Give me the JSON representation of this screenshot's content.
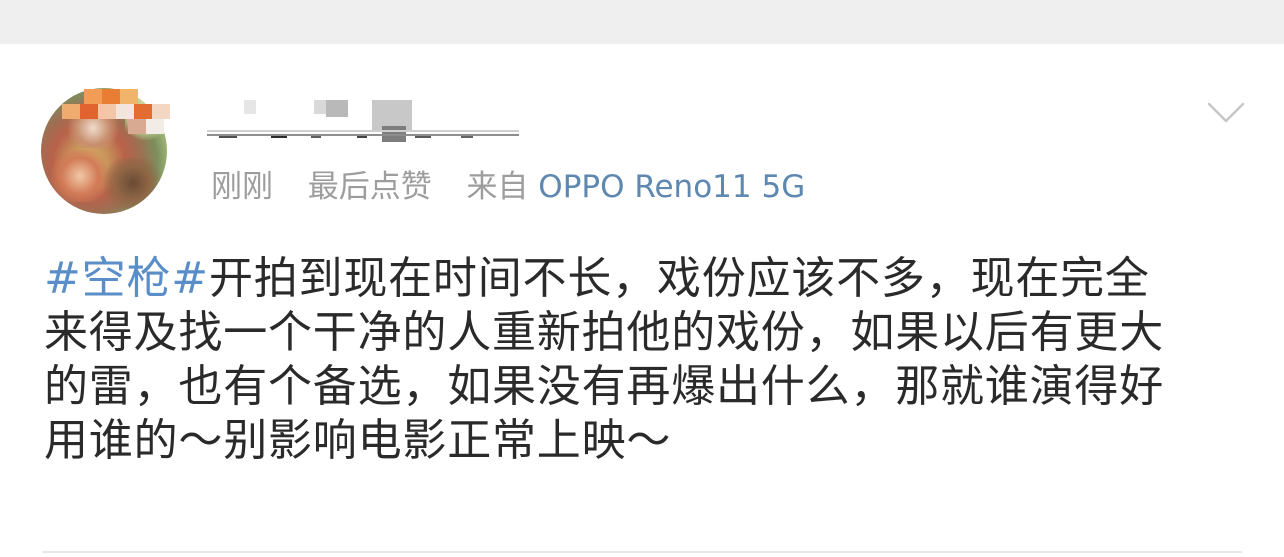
{
  "post": {
    "meta": {
      "time": "刚刚",
      "liked": "最后点赞",
      "source_prefix": "来自",
      "device": "OPPO Reno11 5G"
    },
    "content": {
      "hashtag": "#空枪#",
      "line1_rest": "开拍到现在时间不长，戏份应该不多，现在完全",
      "line2": "来得及找一个干净的人重新拍他的戏份，如果以后有更大",
      "line3": "的雷，也有个备选，如果没有再爆出什么，那就谁演得好",
      "line4": "用谁的～别影响电影正常上映～"
    }
  },
  "icons": {
    "menu": "chevron-down-icon",
    "avatar": "avatar-image"
  },
  "colors": {
    "background": "#efefef",
    "card": "#ffffff",
    "meta_text": "#9d9d9d",
    "device_text": "#5e88b0",
    "hashtag": "#5a8ec8",
    "body_text": "#2a2a2a"
  }
}
